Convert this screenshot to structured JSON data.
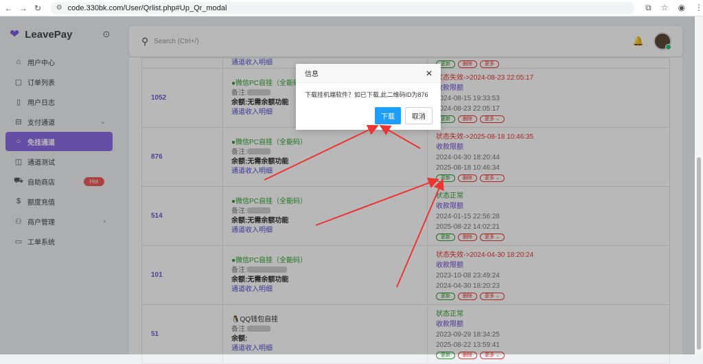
{
  "browser": {
    "url": "code.330bk.com/User/Qrlist.php#Up_Qr_modal"
  },
  "brand": {
    "name": "LeavePay"
  },
  "sidebar": {
    "items": [
      {
        "label": "用户中心",
        "icon": "home-icon"
      },
      {
        "label": "订单列表",
        "icon": "list-icon"
      },
      {
        "label": "用户日志",
        "icon": "log-icon"
      },
      {
        "label": "支付通道",
        "icon": "cart-icon",
        "chevron": "⌄"
      },
      {
        "label": "免挂通道",
        "icon": "dot-icon",
        "active": true
      },
      {
        "label": "通道测试",
        "icon": "book-icon"
      },
      {
        "label": "自助商店",
        "icon": "truck-icon",
        "badge": "Hot"
      },
      {
        "label": "额度充值",
        "icon": "dollar-icon"
      },
      {
        "label": "商户管理",
        "icon": "users-icon",
        "chevron": "›"
      },
      {
        "label": "工单系统",
        "icon": "file-icon"
      }
    ]
  },
  "topbar": {
    "search_placeholder": "Search (Ctrl+/)"
  },
  "table": {
    "top_partial_link": "通道收入明细",
    "top_partial_buttons": [
      "更新",
      "删除",
      "更多"
    ],
    "rows": [
      {
        "id": "1052",
        "channel": "微信PC自挂（全能码）",
        "note_label": "备注:",
        "balance": "余额:无需余额功能",
        "detail_link": "通道收入明细",
        "status": "状态失效->2024-08-23 22:05:17",
        "limit": "收款限额",
        "time1": "2024-08-15 19:33:53",
        "time2": "2024-08-23 22:05:17"
      },
      {
        "id": "876",
        "channel": "微信PC自挂（全能码）",
        "note_label": "备注:",
        "balance": "余额:无需余额功能",
        "detail_link": "通道收入明细",
        "status": "状态失效->2025-08-18 10:46:35",
        "limit": "收款限额",
        "time1": "2024-04-30 18:20:44",
        "time2": "2025-08-18 10:46:34"
      },
      {
        "id": "514",
        "channel": "微信PC自挂（全能码）",
        "note_label": "备注:",
        "balance": "余额:无需余额功能",
        "detail_link": "通道收入明细",
        "status": "状态正常",
        "limit": "收款限额",
        "time1": "2024-01-15 22:56:28",
        "time2": "2025-08-22 14:02:21"
      },
      {
        "id": "101",
        "channel": "微信PC自挂（全能码）",
        "note_label": "备注:",
        "balance": "余额:无需余额功能",
        "detail_link": "通道收入明细",
        "status": "状态失效->2024-04-30 18:20:24",
        "limit": "收款限额",
        "time1": "2023-10-08 23:49:24",
        "time2": "2024-04-30 18:20:23"
      },
      {
        "id": "51",
        "channel": "QQ钱包自挂",
        "note_label": "备注:",
        "balance": "余额:",
        "detail_link": "通道收入明细",
        "status": "状态正常",
        "limit": "收款限额",
        "time1": "2023-09-29 18:34:25",
        "time2": "2025-08-22 13:59:41"
      }
    ],
    "buttons": {
      "update": "更新",
      "delete": "删除",
      "more": "更多 ⌄"
    }
  },
  "modal": {
    "title": "信息",
    "message": "下载挂机端软件？如已下载,此二维码ID为876",
    "confirm": "下载",
    "cancel": "取消"
  },
  "colors": {
    "accent": "#8c6ee6",
    "primary_button": "#1e9fff",
    "error": "#e53935",
    "success": "#2e9a2e"
  }
}
